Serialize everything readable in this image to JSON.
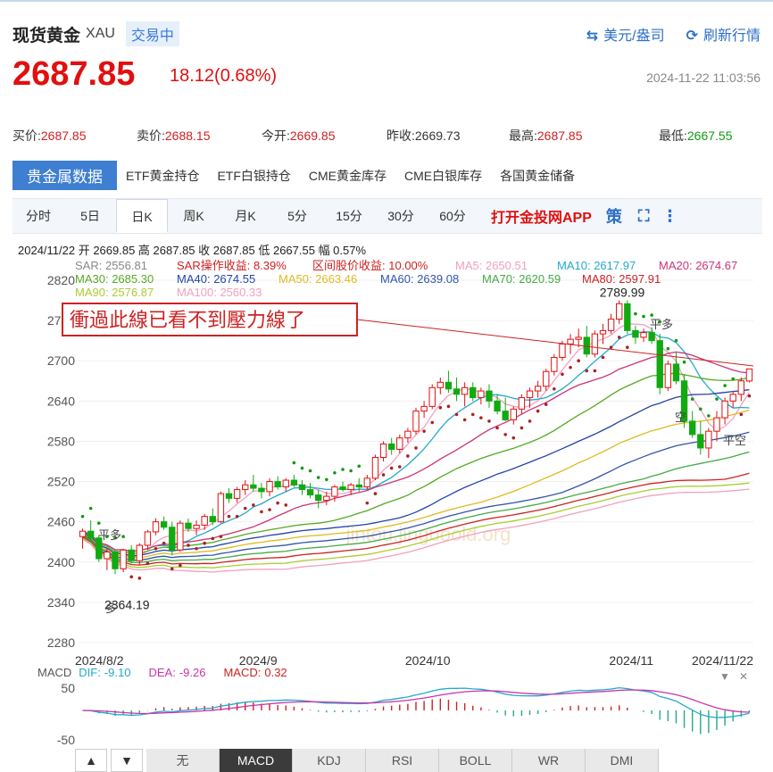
{
  "header": {
    "name": "现货黄金",
    "code": "XAU",
    "status": "交易中",
    "unit_label": "美元/盎司",
    "refresh_label": "刷新行情"
  },
  "quote": {
    "price": "2687.85",
    "change": "18.12(0.68%)",
    "time": "2024-11-22 11:03:56"
  },
  "stats": [
    {
      "label": "买价:",
      "value": "2687.85",
      "color": "red"
    },
    {
      "label": "卖价:",
      "value": "2688.15",
      "color": "red"
    },
    {
      "label": "今开:",
      "value": "2669.85",
      "color": "red"
    },
    {
      "label": "昨收:",
      "value": "2669.73",
      "color": "gray"
    },
    {
      "label": "最高:",
      "value": "2687.85",
      "color": "red"
    },
    {
      "label": "最低:",
      "value": "2667.55",
      "color": "green"
    }
  ],
  "category_tabs": [
    "贵金属数据",
    "ETF黄金持仓",
    "ETF白银持仓",
    "CME黄金库存",
    "CME白银库存",
    "各国黄金储备"
  ],
  "period_tabs": [
    "分时",
    "5日",
    "日K",
    "周K",
    "月K",
    "5分",
    "15分",
    "30分",
    "60分"
  ],
  "active_period": "日K",
  "app_link": "打开金投网APP",
  "ohlc_line": "2024/11/22  开 2669.85  高 2687.85  收 2687.85  低 2667.55  幅 0.57%",
  "colors": {
    "up": "#e01010",
    "down": "#11aa11",
    "accent": "#3e7fd1"
  },
  "indicator_buttons": [
    "无",
    "MACD",
    "KDJ",
    "RSI",
    "BOLL",
    "WR",
    "DMI"
  ],
  "active_indicator": "MACD",
  "chart_data": {
    "type": "candlestick",
    "ylim": [
      2280,
      2820
    ],
    "y_ticks": [
      "2820",
      "2760",
      "2700",
      "2640",
      "2580",
      "2520",
      "2460",
      "2400",
      "2340",
      "2280"
    ],
    "x_labels": [
      "2024/8/2",
      "2024/9",
      "2024/10",
      "2024/11",
      "2024/11/22"
    ],
    "indicator_values": [
      {
        "name": "SAR",
        "value": "2556.81",
        "color": "#888888"
      },
      {
        "name": "SAR操作收益",
        "value": "8.39%",
        "color": "#d02020"
      },
      {
        "name": "区间股价收益",
        "value": "10.00%",
        "color": "#d02020"
      },
      {
        "name": "MA5",
        "value": "2650.51",
        "color": "#f0a0c0"
      },
      {
        "name": "MA10",
        "value": "2617.97",
        "color": "#22aacc"
      },
      {
        "name": "MA20",
        "value": "2674.67",
        "color": "#cc3377"
      },
      {
        "name": "MA30",
        "value": "2685.30",
        "color": "#55aa22"
      },
      {
        "name": "MA40",
        "value": "2674.55",
        "color": "#2244aa"
      },
      {
        "name": "MA50",
        "value": "2663.46",
        "color": "#ddbb22"
      },
      {
        "name": "MA60",
        "value": "2639.08",
        "color": "#3355aa"
      },
      {
        "name": "MA70",
        "value": "2620.59",
        "color": "#44aa44"
      },
      {
        "name": "MA80",
        "value": "2597.91",
        "color": "#cc2222"
      },
      {
        "name": "MA90",
        "value": "2576.87",
        "color": "#aacc33"
      },
      {
        "name": "MA100",
        "value": "2560.33",
        "color": "#f0a0c0"
      }
    ],
    "annotations": {
      "high_label": "2789.99",
      "low_label": "2364.19",
      "signal_labels": [
        "平多",
        "平多",
        "空",
        "平空",
        "多"
      ],
      "callout": "衝過此線已看不到壓力線了"
    },
    "watermark": "jintou.jinguoold.org",
    "macd": {
      "label": "MACD",
      "dif": {
        "label": "DIF:",
        "value": "-9.10"
      },
      "dea": {
        "label": "DEA:",
        "value": "-9.26"
      },
      "macd": {
        "label": "MACD:",
        "value": "0.32"
      },
      "y_ticks": [
        "50",
        "-50"
      ]
    },
    "ohlc": [
      [
        2438,
        2450,
        2420,
        2446
      ],
      [
        2446,
        2462,
        2430,
        2436
      ],
      [
        2436,
        2440,
        2400,
        2405
      ],
      [
        2405,
        2420,
        2388,
        2415
      ],
      [
        2415,
        2418,
        2382,
        2390
      ],
      [
        2390,
        2420,
        2385,
        2418
      ],
      [
        2418,
        2425,
        2398,
        2402
      ],
      [
        2402,
        2428,
        2396,
        2425
      ],
      [
        2425,
        2448,
        2418,
        2445
      ],
      [
        2445,
        2465,
        2440,
        2460
      ],
      [
        2460,
        2468,
        2448,
        2452
      ],
      [
        2452,
        2460,
        2410,
        2418
      ],
      [
        2418,
        2462,
        2415,
        2458
      ],
      [
        2458,
        2465,
        2445,
        2450
      ],
      [
        2450,
        2462,
        2440,
        2455
      ],
      [
        2455,
        2472,
        2448,
        2468
      ],
      [
        2468,
        2480,
        2455,
        2460
      ],
      [
        2460,
        2505,
        2458,
        2502
      ],
      [
        2502,
        2510,
        2488,
        2495
      ],
      [
        2495,
        2512,
        2488,
        2508
      ],
      [
        2508,
        2522,
        2500,
        2515
      ],
      [
        2515,
        2530,
        2505,
        2510
      ],
      [
        2510,
        2518,
        2495,
        2505
      ],
      [
        2505,
        2525,
        2498,
        2520
      ],
      [
        2520,
        2528,
        2508,
        2512
      ],
      [
        2512,
        2525,
        2505,
        2522
      ],
      [
        2522,
        2530,
        2512,
        2515
      ],
      [
        2515,
        2522,
        2500,
        2508
      ],
      [
        2508,
        2518,
        2495,
        2500
      ],
      [
        2500,
        2508,
        2480,
        2492
      ],
      [
        2492,
        2505,
        2485,
        2498
      ],
      [
        2498,
        2515,
        2490,
        2512
      ],
      [
        2512,
        2520,
        2505,
        2508
      ],
      [
        2508,
        2518,
        2500,
        2515
      ],
      [
        2515,
        2525,
        2505,
        2512
      ],
      [
        2512,
        2530,
        2508,
        2525
      ],
      [
        2525,
        2560,
        2522,
        2556
      ],
      [
        2556,
        2580,
        2550,
        2576
      ],
      [
        2576,
        2585,
        2560,
        2568
      ],
      [
        2568,
        2590,
        2562,
        2585
      ],
      [
        2585,
        2600,
        2578,
        2595
      ],
      [
        2595,
        2630,
        2590,
        2625
      ],
      [
        2625,
        2640,
        2615,
        2632
      ],
      [
        2632,
        2665,
        2628,
        2660
      ],
      [
        2660,
        2675,
        2650,
        2668
      ],
      [
        2668,
        2685,
        2652,
        2658
      ],
      [
        2658,
        2675,
        2640,
        2650
      ],
      [
        2650,
        2668,
        2632,
        2660
      ],
      [
        2660,
        2668,
        2640,
        2645
      ],
      [
        2645,
        2660,
        2635,
        2655
      ],
      [
        2655,
        2665,
        2630,
        2640
      ],
      [
        2640,
        2650,
        2620,
        2625
      ],
      [
        2625,
        2645,
        2610,
        2612
      ],
      [
        2612,
        2632,
        2605,
        2628
      ],
      [
        2628,
        2650,
        2620,
        2645
      ],
      [
        2645,
        2660,
        2630,
        2655
      ],
      [
        2655,
        2670,
        2645,
        2662
      ],
      [
        2662,
        2688,
        2655,
        2684
      ],
      [
        2684,
        2710,
        2678,
        2705
      ],
      [
        2705,
        2730,
        2700,
        2725
      ],
      [
        2725,
        2740,
        2710,
        2732
      ],
      [
        2732,
        2748,
        2720,
        2735
      ],
      [
        2735,
        2752,
        2705,
        2710
      ],
      [
        2710,
        2745,
        2705,
        2740
      ],
      [
        2740,
        2755,
        2725,
        2745
      ],
      [
        2745,
        2770,
        2740,
        2762
      ],
      [
        2762,
        2790,
        2755,
        2785
      ],
      [
        2785,
        2790,
        2740,
        2745
      ],
      [
        2745,
        2752,
        2725,
        2735
      ],
      [
        2735,
        2748,
        2728,
        2742
      ],
      [
        2742,
        2750,
        2725,
        2730
      ],
      [
        2730,
        2740,
        2650,
        2660
      ],
      [
        2660,
        2700,
        2655,
        2695
      ],
      [
        2695,
        2712,
        2665,
        2670
      ],
      [
        2670,
        2680,
        2600,
        2610
      ],
      [
        2610,
        2625,
        2585,
        2590
      ],
      [
        2590,
        2610,
        2560,
        2570
      ],
      [
        2570,
        2600,
        2555,
        2595
      ],
      [
        2595,
        2625,
        2580,
        2615
      ],
      [
        2615,
        2645,
        2605,
        2640
      ],
      [
        2640,
        2655,
        2630,
        2650
      ],
      [
        2650,
        2675,
        2640,
        2670
      ],
      [
        2669.85,
        2687.85,
        2667.55,
        2687.85
      ]
    ]
  }
}
